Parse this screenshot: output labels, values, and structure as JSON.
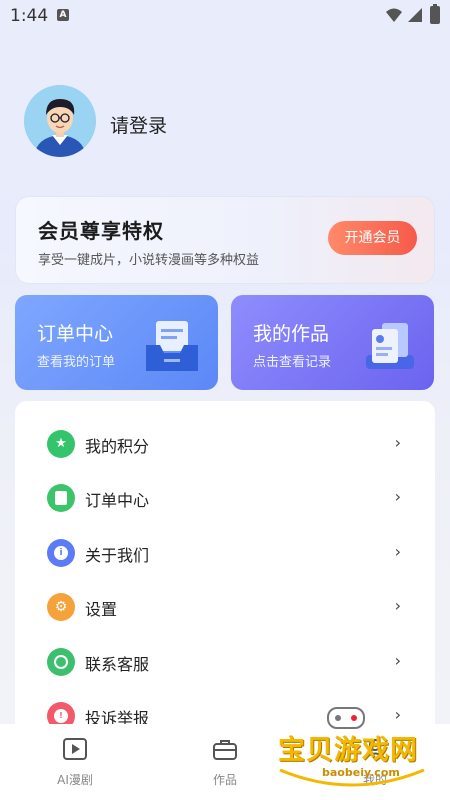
{
  "status_bar": {
    "time": "1:44"
  },
  "profile": {
    "login_text": "请登录"
  },
  "vip": {
    "title": "会员尊享特权",
    "subtitle": "享受一键成片，小说转漫画等多种权益",
    "button": "开通会员"
  },
  "cards": [
    {
      "title": "订单中心",
      "subtitle": "查看我的订单",
      "icon": "order-box-icon"
    },
    {
      "title": "我的作品",
      "subtitle": "点击查看记录",
      "icon": "document-stack-icon"
    }
  ],
  "menu": {
    "items": [
      {
        "label": "我的积分",
        "icon": "star-icon",
        "color": "#34c46c"
      },
      {
        "label": "订单中心",
        "icon": "clipboard-icon",
        "color": "#3cc46c"
      },
      {
        "label": "关于我们",
        "icon": "info-icon",
        "color": "#5b7cf6"
      },
      {
        "label": "设置",
        "icon": "gear-icon",
        "color": "#f6a23a"
      },
      {
        "label": "联系客服",
        "icon": "headset-icon",
        "color": "#3cbf6e"
      },
      {
        "label": "投诉举报",
        "icon": "report-icon",
        "color": "#f2596a"
      }
    ],
    "chevron": "›"
  },
  "tabbar": {
    "tabs": [
      {
        "label": "AI漫剧",
        "icon": "play-icon"
      },
      {
        "label": "作品",
        "icon": "briefcase-icon"
      },
      {
        "label": "我的",
        "icon": "user-icon"
      }
    ]
  },
  "watermark": {
    "text": "宝贝游戏网",
    "url": "baobeiy.com"
  }
}
